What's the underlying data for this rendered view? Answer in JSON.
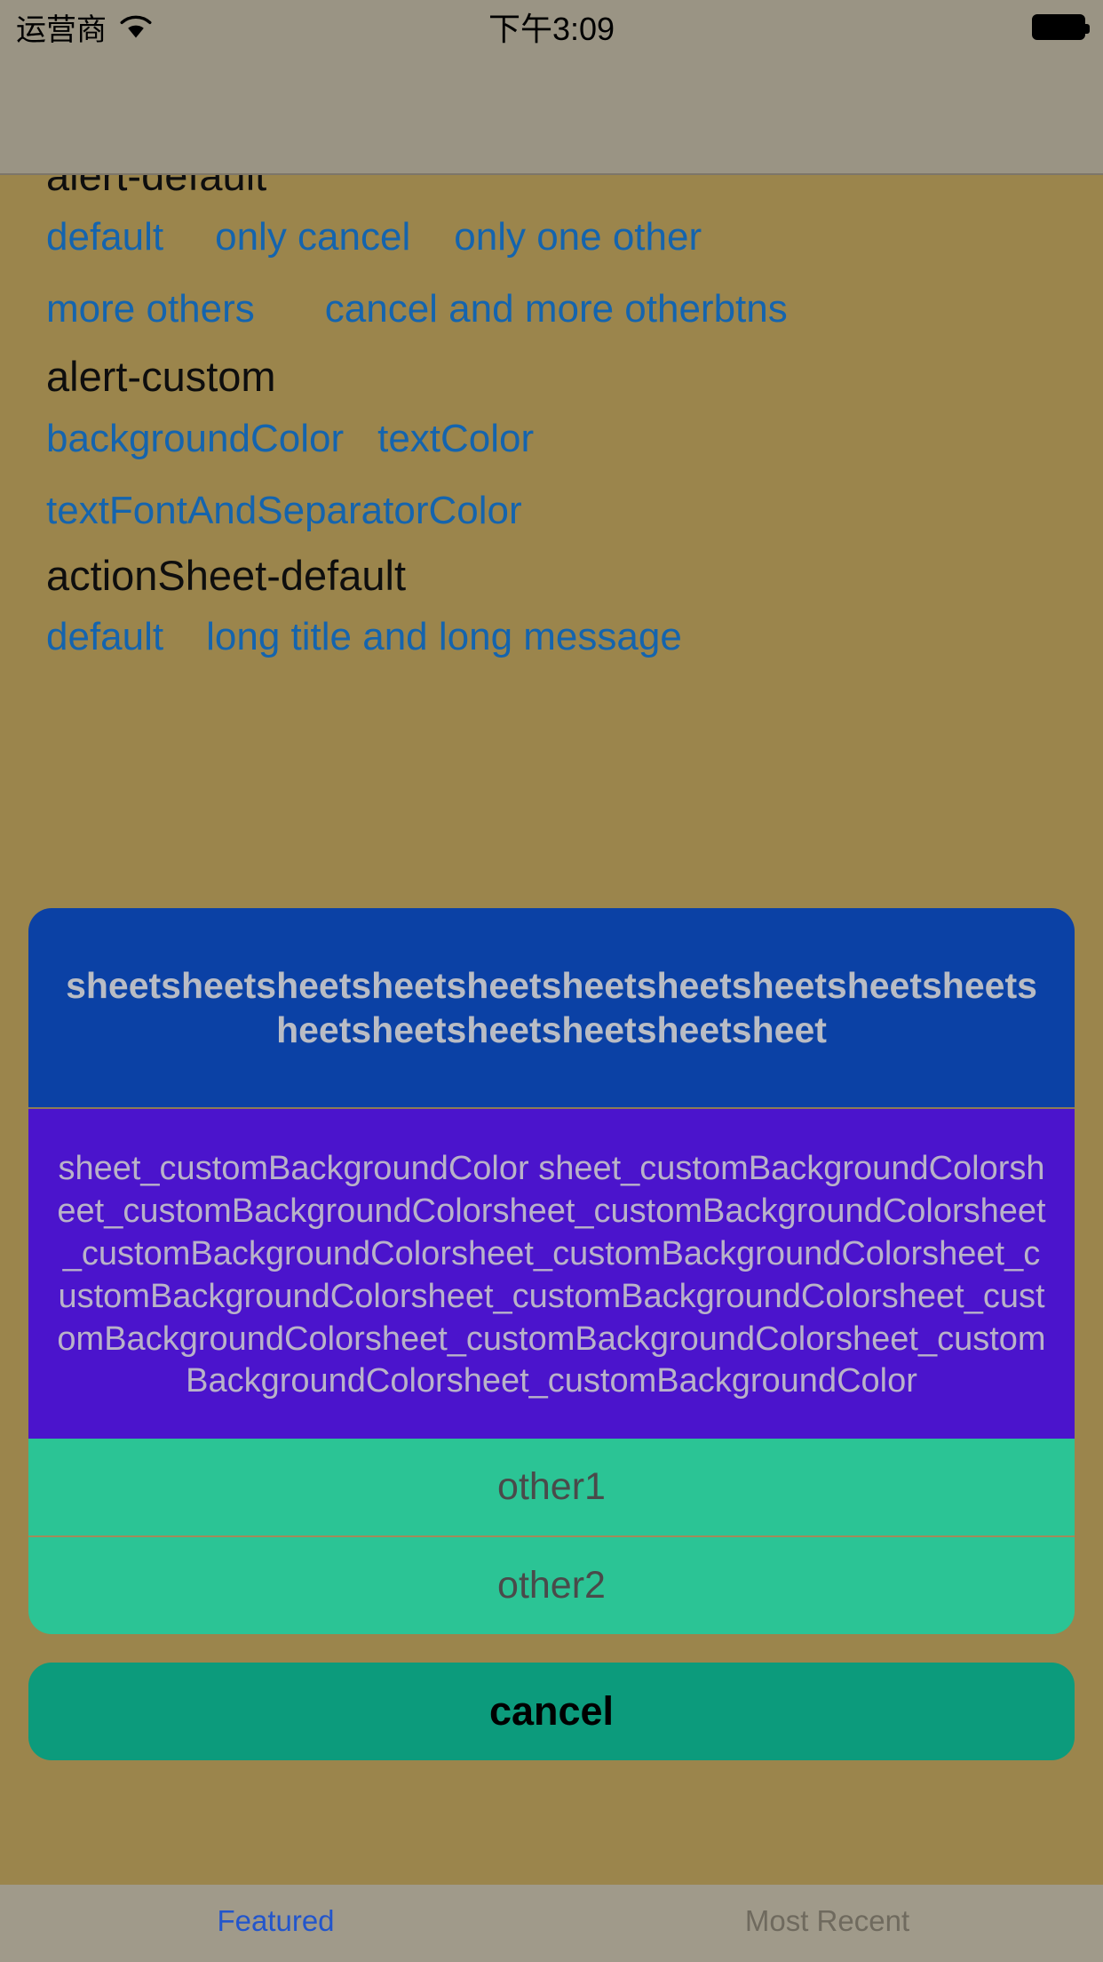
{
  "status_bar": {
    "carrier": "运营商",
    "wifi_icon": "wifi-icon",
    "time": "下午3:09",
    "battery_icon": "battery-icon"
  },
  "page": {
    "sections": [
      {
        "title": "alert-default",
        "rows": [
          [
            "default",
            "only cancel",
            "only one other"
          ],
          [
            "more others",
            "cancel and more otherbtns"
          ]
        ]
      },
      {
        "title": "alert-custom",
        "rows": [
          [
            "backgroundColor",
            "textColor"
          ],
          [
            "textFontAndSeparatorColor"
          ]
        ]
      },
      {
        "title": "actionSheet-default",
        "rows": [
          [
            "default",
            "long title and long message"
          ]
        ]
      }
    ]
  },
  "action_sheet": {
    "title": "sheetsheetsheetsheetsheetsheetsheetsheetsheetsheetsheetsheetsheetsheetsheetsheet",
    "message": "sheet_customBackgroundColor sheet_customBackgroundColorsheet_customBackgroundColorsheet_customBackgroundColorsheet_customBackgroundColorsheet_customBackgroundColorsheet_customBackgroundColorsheet_customBackgroundColorsheet_customBackgroundColorsheet_customBackgroundColorsheet_customBackgroundColorsheet_customBackgroundColor",
    "buttons": [
      {
        "label": "other1",
        "style": "other"
      },
      {
        "label": "other2",
        "style": "other"
      }
    ],
    "cancel_label": "cancel",
    "colors": {
      "title_background": "#0b41a5",
      "title_text": "#b9bcc4",
      "message_background": "#4b14cc",
      "message_text": "#b9b2c8",
      "other_button_background": "#2bc495",
      "other_button_text": "#4a4a4a",
      "cancel_background": "#0c9b7c",
      "cancel_text": "#000000",
      "backdrop": "#9b854c"
    }
  },
  "tab_bar": {
    "tabs": [
      {
        "label": "Featured",
        "selected": true
      },
      {
        "label": "Most Recent",
        "selected": false
      }
    ]
  }
}
